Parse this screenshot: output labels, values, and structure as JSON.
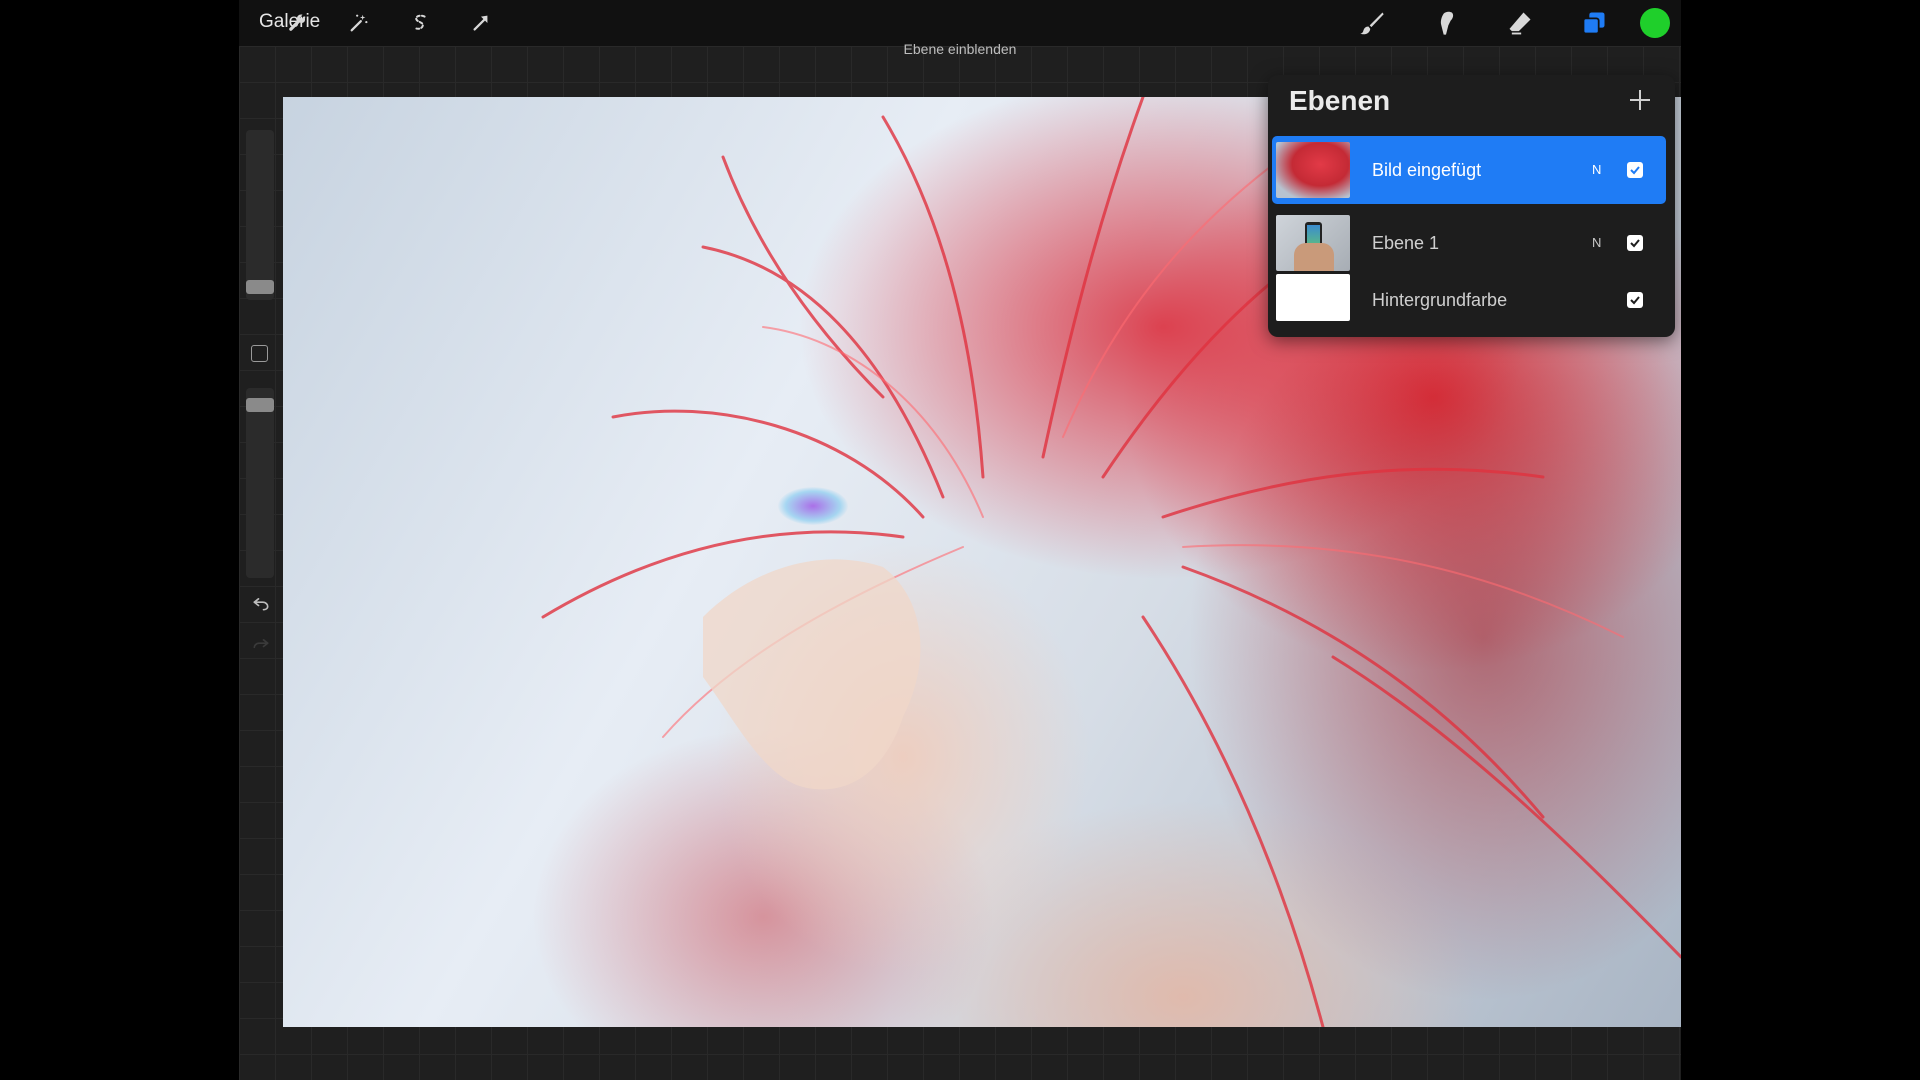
{
  "toolbar": {
    "gallery_label": "Galerie",
    "actions_icon": "wrench-icon",
    "adjustments_icon": "magic-wand-icon",
    "selection_icon": "selection-icon",
    "transform_icon": "transform-arrow-icon",
    "brush_icon": "brush-icon",
    "smudge_icon": "smudge-icon",
    "eraser_icon": "eraser-icon",
    "layers_icon": "layers-icon",
    "current_color": "#1fcf2b",
    "layers_accent": "#1f7cf5"
  },
  "hint": "Ebene einblenden",
  "sidebar": {
    "undo_icon": "undo-icon",
    "redo_icon": "redo-icon",
    "modify_icon": "square-modify-icon"
  },
  "layers_panel": {
    "title": "Ebenen",
    "add_icon": "plus-icon",
    "layers": [
      {
        "name": "Bild eingefügt",
        "mode": "N",
        "visible": true,
        "active": true
      },
      {
        "name": "Ebene 1",
        "mode": "N",
        "visible": true,
        "active": false
      },
      {
        "name": "Hintergrundfarbe",
        "mode": "",
        "visible": true,
        "active": false
      }
    ]
  }
}
